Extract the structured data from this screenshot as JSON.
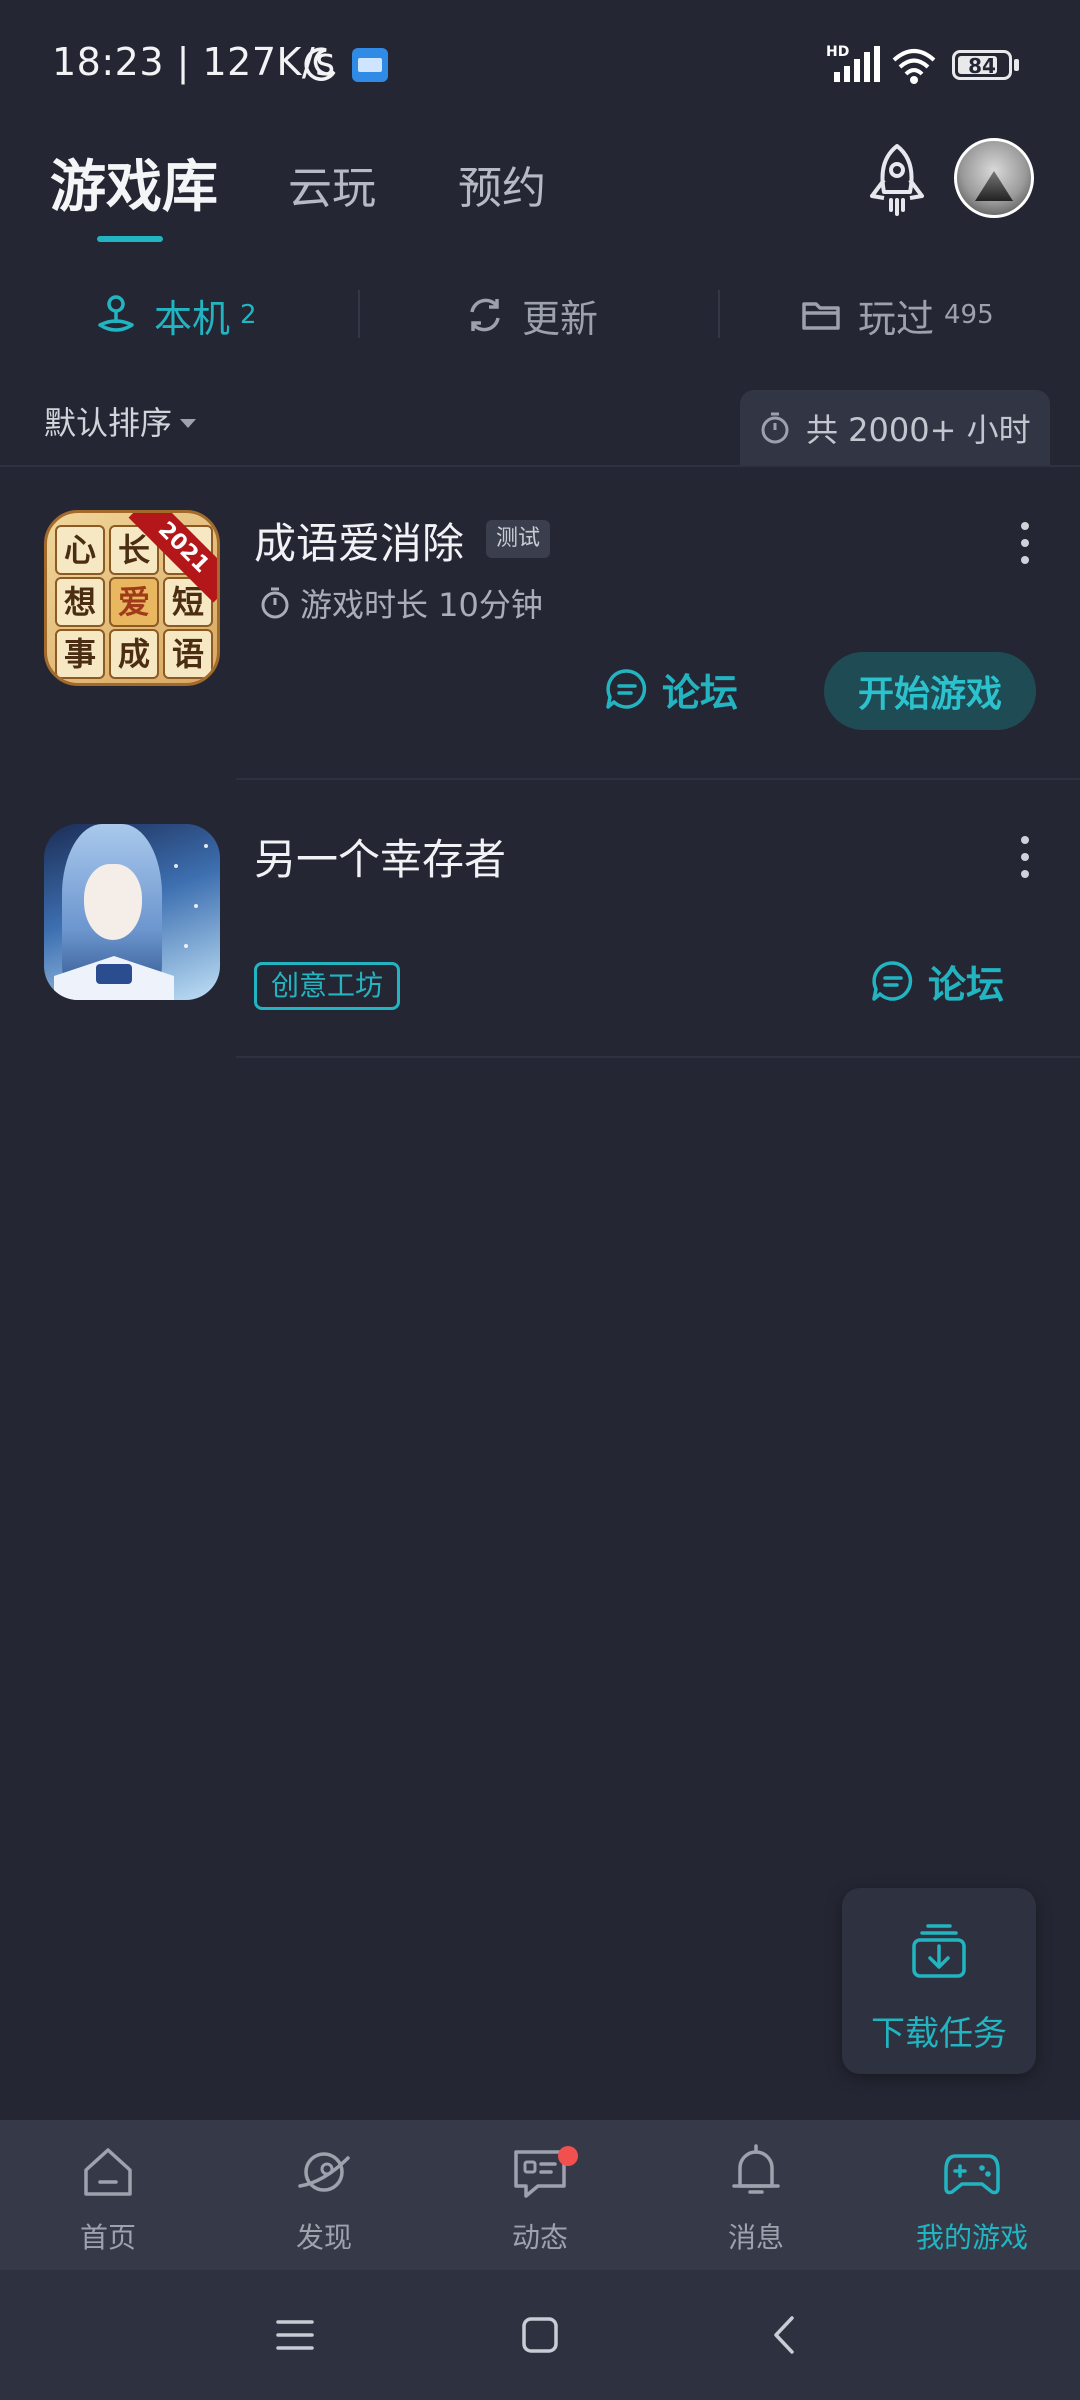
{
  "status_bar": {
    "time_speed": "18:23 | 127K/s",
    "network_label": "HD",
    "battery_level": "84",
    "battery_fraction": 0.84
  },
  "header": {
    "tabs": [
      {
        "label": "游戏库",
        "active": true
      },
      {
        "label": "云玩",
        "active": false
      },
      {
        "label": "预约",
        "active": false
      }
    ],
    "rocket_icon": "rocket-icon",
    "avatar_icon": "user-avatar"
  },
  "subtabs": [
    {
      "label": "本机",
      "count": "2",
      "icon": "joystick-icon",
      "active": true
    },
    {
      "label": "更新",
      "count": "",
      "icon": "refresh-icon",
      "active": false
    },
    {
      "label": "玩过",
      "count": "495",
      "icon": "folder-icon",
      "active": false
    }
  ],
  "sort": {
    "label": "默认排序",
    "total_playtime": "共 2000+ 小时"
  },
  "games": [
    {
      "title": "成语爱消除",
      "tag": "测试",
      "playtime": "游戏时长 10分钟",
      "forum_label": "论坛",
      "start_label": "开始游戏",
      "icon": {
        "ribbon": "2021",
        "chars": [
          "心",
          "长",
          "",
          "想",
          "爱",
          "短",
          "事",
          "成",
          "语"
        ]
      }
    },
    {
      "title": "另一个幸存者",
      "workshop_label": "创意工坊",
      "forum_label": "论坛"
    }
  ],
  "download_task": {
    "label": "下载任务"
  },
  "bottom_nav": [
    {
      "label": "首页",
      "icon": "home-icon",
      "active": false
    },
    {
      "label": "发现",
      "icon": "planet-icon",
      "active": false
    },
    {
      "label": "动态",
      "icon": "chat-icon",
      "active": false,
      "badge": true
    },
    {
      "label": "消息",
      "icon": "bell-icon",
      "active": false
    },
    {
      "label": "我的游戏",
      "icon": "gamepad-icon",
      "active": true
    }
  ],
  "colors": {
    "background": "#242733",
    "accent": "#22b5c1",
    "nav_background": "#363a48",
    "start_button": "#1f4b55",
    "badge_red": "#f24f4f"
  }
}
